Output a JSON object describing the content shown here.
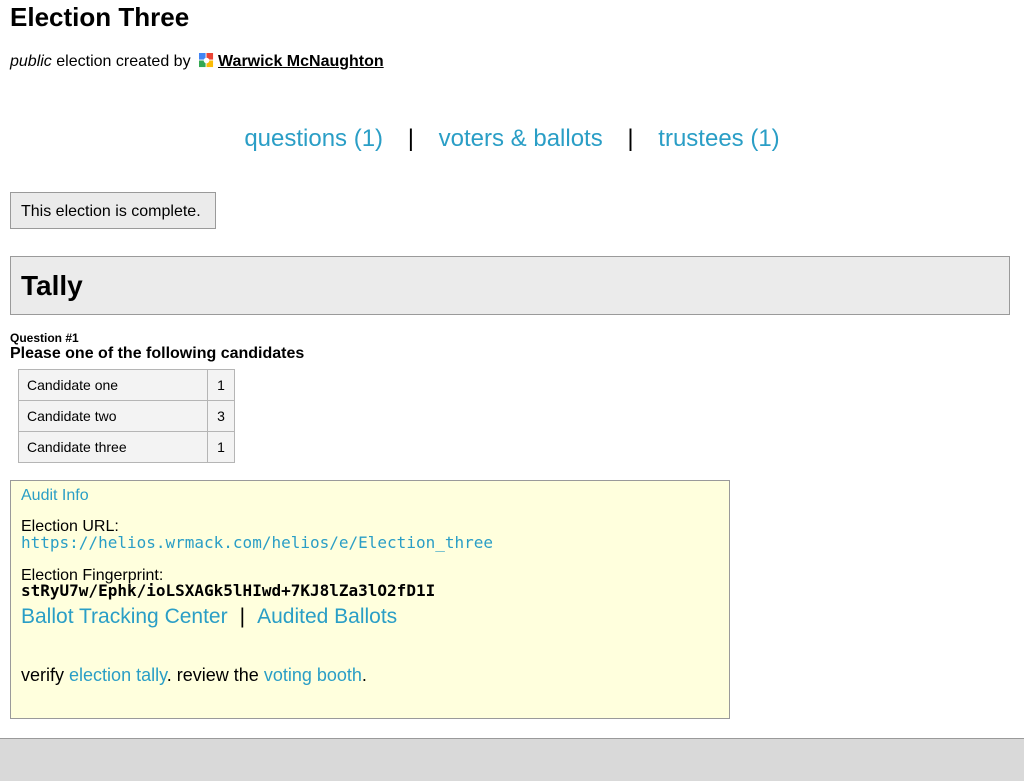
{
  "election": {
    "name": "Election Three",
    "visibility": "public",
    "created_by_text": "election created by",
    "admin_name": "Warwick McNaughton"
  },
  "nav": {
    "questions": "questions (1)",
    "voters": "voters & ballots",
    "trustees": "trustees (1)",
    "separator": "|"
  },
  "status": {
    "message": "This election is complete."
  },
  "tally": {
    "heading": "Tally",
    "question_number": "Question #1",
    "question_text": "Please one of the following candidates",
    "results": [
      {
        "candidate": "Candidate one",
        "count": "1"
      },
      {
        "candidate": "Candidate two",
        "count": "3"
      },
      {
        "candidate": "Candidate three",
        "count": "1"
      }
    ]
  },
  "audit": {
    "title": "Audit Info",
    "url_label": "Election URL:",
    "url": "https://helios.wrmack.com/helios/e/Election_three",
    "fingerprint_label": "Election Fingerprint:",
    "fingerprint": "stRyU7w/Ephk/ioLSXAGk5lHIwd+7KJ8lZa3lO2fD1I",
    "ballot_tracking": "Ballot Tracking Center",
    "audited_ballots": "Audited Ballots",
    "separator": "|",
    "verify_prefix": "verify",
    "verify_link": "election tally",
    "review_prefix": ". review the",
    "review_link": "voting booth",
    "review_suffix": "."
  },
  "colors": {
    "link": "#2a9ec6",
    "panel_gray": "#ebebeb",
    "audit_yellow": "#ffffdd"
  }
}
